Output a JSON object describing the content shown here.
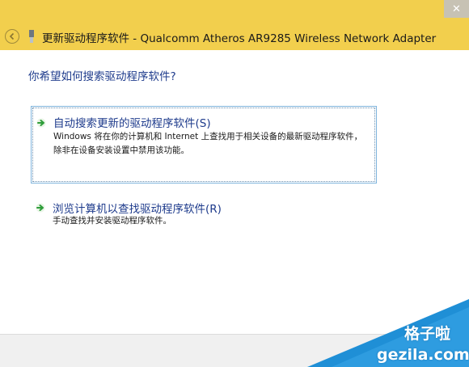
{
  "window": {
    "title": "更新驱动程序软件 - Qualcomm Atheros AR9285 Wireless Network Adapter",
    "close_glyph": "✕"
  },
  "icons": {
    "back": "back-arrow-icon",
    "device": "device-icon",
    "option_arrow": "green-arrow-icon"
  },
  "main": {
    "question": "你希望如何搜索驱动程序软件?",
    "options": [
      {
        "title": "自动搜索更新的驱动程序软件(S)",
        "description": "Windows 将在你的计算机和 Internet 上查找用于相关设备的最新驱动程序软件，除非在设备安装设置中禁用该功能。"
      },
      {
        "title": "浏览计算机以查找驱动程序软件(R)",
        "description": "手动查找并安装驱动程序软件。"
      }
    ]
  },
  "watermark": {
    "name": "格子啦",
    "url": "gezila.com"
  },
  "colors": {
    "titlebar": "#f2cf4d",
    "link_blue": "#1e3b8c",
    "selection_border": "#7fb4dd",
    "arrow_green": "#2e9d3a",
    "watermark_blue": "#1f8fd6"
  }
}
